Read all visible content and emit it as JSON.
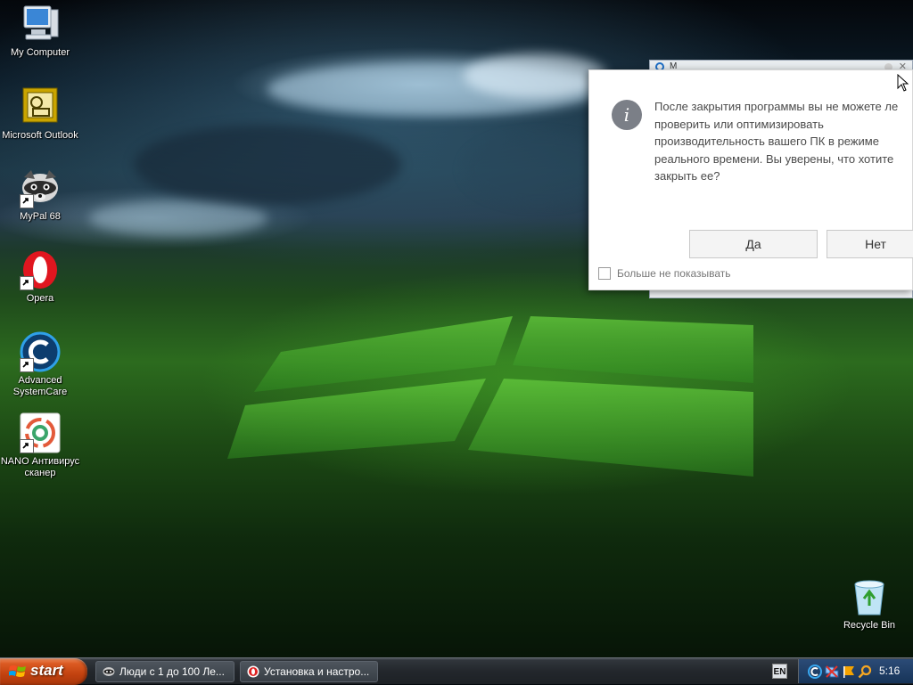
{
  "desktop": {
    "icons": [
      {
        "label": "My Computer",
        "icon": "my-computer-icon"
      },
      {
        "label": "Microsoft Outlook",
        "icon": "outlook-icon"
      },
      {
        "label": "MyPal 68",
        "icon": "mypal-icon"
      },
      {
        "label": "Opera",
        "icon": "opera-icon"
      },
      {
        "label": "Advanced SystemCare",
        "icon": "advanced-systemcare-icon"
      },
      {
        "label": "NANO Антивирус сканер",
        "icon": "nano-antivirus-icon"
      },
      {
        "label": "Recycle Bin",
        "icon": "recycle-bin-icon"
      }
    ]
  },
  "background_window": {
    "title": "М"
  },
  "dialog": {
    "message": "После закрытия программы вы не можете ле\nпроверить или оптимизировать\nпроизводительность вашего ПК в режиме\nреального времени. Вы уверены, что хотите\nзакрыть ее?",
    "yes_label": "Да",
    "no_label": "Нет",
    "dont_show_label": "Больше не показывать",
    "dont_show_checked": false,
    "icon": "info-icon"
  },
  "taskbar": {
    "start_label": "start",
    "buttons": [
      {
        "label": "Люди с 1 до 100 Ле...",
        "icon": "mypal-icon"
      },
      {
        "label": "Установка и настро...",
        "icon": "opera-icon"
      }
    ],
    "language": "EN",
    "tray_icons": [
      "advanced-systemcare-tray-icon",
      "network-tray-icon",
      "flag-tray-icon",
      "search-tray-icon"
    ],
    "clock": "5:16"
  },
  "colors": {
    "start_button": "#d4501a",
    "tray": "#1f3f68",
    "info_icon": "#7b7f87"
  }
}
